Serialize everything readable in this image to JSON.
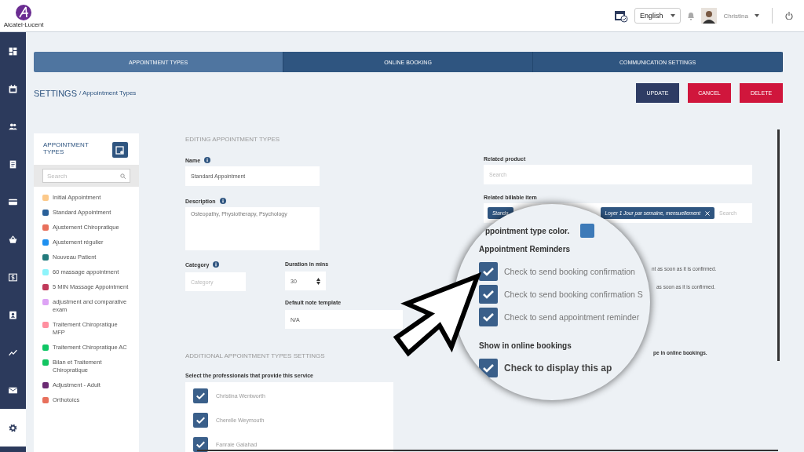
{
  "header": {
    "logo_text": "Alcatel·Lucent",
    "language": "English",
    "user": "Christina"
  },
  "nav": [
    {
      "kind": "dashboard",
      "selected": false
    },
    {
      "kind": "calendar",
      "selected": false
    },
    {
      "kind": "people",
      "selected": false
    },
    {
      "kind": "notes",
      "selected": false
    },
    {
      "kind": "card",
      "selected": false
    },
    {
      "kind": "basket",
      "selected": false
    },
    {
      "kind": "dollar",
      "selected": false
    },
    {
      "kind": "contact",
      "selected": false
    },
    {
      "kind": "chart",
      "selected": false
    },
    {
      "kind": "mail",
      "selected": false
    },
    {
      "kind": "settings",
      "selected": true
    }
  ],
  "tabs": [
    {
      "label": "APPOINTMENT TYPES",
      "selected": true
    },
    {
      "label": "ONLINE BOOKING",
      "selected": false
    },
    {
      "label": "COMMUNICATION SETTINGS",
      "selected": false
    }
  ],
  "breadcrumb": {
    "root": "SETTINGS",
    "current": "/ Appointment Types"
  },
  "buttons": [
    {
      "label": "UPDATE",
      "kind": "primary"
    },
    {
      "label": "CANCEL",
      "kind": "danger"
    },
    {
      "label": "DELETE",
      "kind": "danger"
    }
  ],
  "types_panel": {
    "title": "APPOINTMENT TYPES",
    "search_placeholder": "Search",
    "items": [
      {
        "name": "Initial Appointment",
        "color": "#fcc98a"
      },
      {
        "name": "Standard Appointment",
        "color": "#2a6099"
      },
      {
        "name": "Ajustement Chiropratique",
        "color": "#e8705c"
      },
      {
        "name": "Ajustement régulier",
        "color": "#1e90f0"
      },
      {
        "name": "Nouveau Patient",
        "color": "#237a7c"
      },
      {
        "name": "60 massage appointment",
        "color": "#8ef4fb"
      },
      {
        "name": "5 MIN Massage Appointment",
        "color": "#c0395a"
      },
      {
        "name": "adjustment and comparative exam",
        "color": "#dda3f5"
      },
      {
        "name": "Traitement Chiropratique MFP",
        "color": "#ff8fa0"
      },
      {
        "name": "Traitement Chiropratique AC",
        "color": "#0fc665"
      },
      {
        "name": "Bilan et Traitement Chiropratique",
        "color": "#12c561"
      },
      {
        "name": "Adjustment - Adult",
        "color": "#6b2a72"
      },
      {
        "name": "Orthotoics",
        "color": "#e8705c"
      }
    ]
  },
  "form": {
    "heading": "EDITING APPOINTMENT TYPES",
    "name": {
      "label": "Name",
      "value": "Standard Appointment"
    },
    "description": {
      "label": "Description",
      "value": "Osteopathy, Physiotherapy, Psychology"
    },
    "category": {
      "label": "Category",
      "placeholder": "Category"
    },
    "duration": {
      "label": "Duration in mins",
      "value": "30"
    },
    "note_template": {
      "label": "Default note template",
      "value": "N/A"
    },
    "related_product": {
      "label": "Related product",
      "placeholder": "Search"
    },
    "related_billable": {
      "label": "Related billable item",
      "tags": [
        {
          "text": "Standa",
          "closable": false
        },
        {
          "text": "Loyer 1 Jour par semaine, mensuellement",
          "closable": true
        }
      ],
      "placeholder": "Search"
    },
    "fragments": [
      {
        "text": "nt as soon as it is confirmed.",
        "kind": "plain"
      },
      {
        "text": "as soon as it is confirmed.",
        "kind": "plain"
      },
      {
        "text": "pe in online bookings.",
        "kind": "bold"
      }
    ],
    "additional_heading": "ADDITIONAL APPOINTMENT TYPES SETTINGS",
    "professionals_label": "Select the professionals that provide this service",
    "professionals": [
      {
        "name": "Christina Wentworth",
        "checked": true
      },
      {
        "name": "Cherelle Weymouth",
        "checked": true
      },
      {
        "name": "Fanraie Galahad",
        "checked": true
      }
    ]
  },
  "magnifier": {
    "color_label": "ppointment type color.",
    "color": "#3d7ab8",
    "reminders_heading": "Appointment Reminders",
    "reminders": [
      {
        "label": "Check to send booking confirmation",
        "checked": true
      },
      {
        "label": "Check to send booking confirmation S",
        "checked": true
      },
      {
        "label": "Check to send appointment reminder",
        "checked": true
      }
    ],
    "online_heading": "Show in online bookings",
    "online_label": "Check to display this ap",
    "online_checked": true
  }
}
